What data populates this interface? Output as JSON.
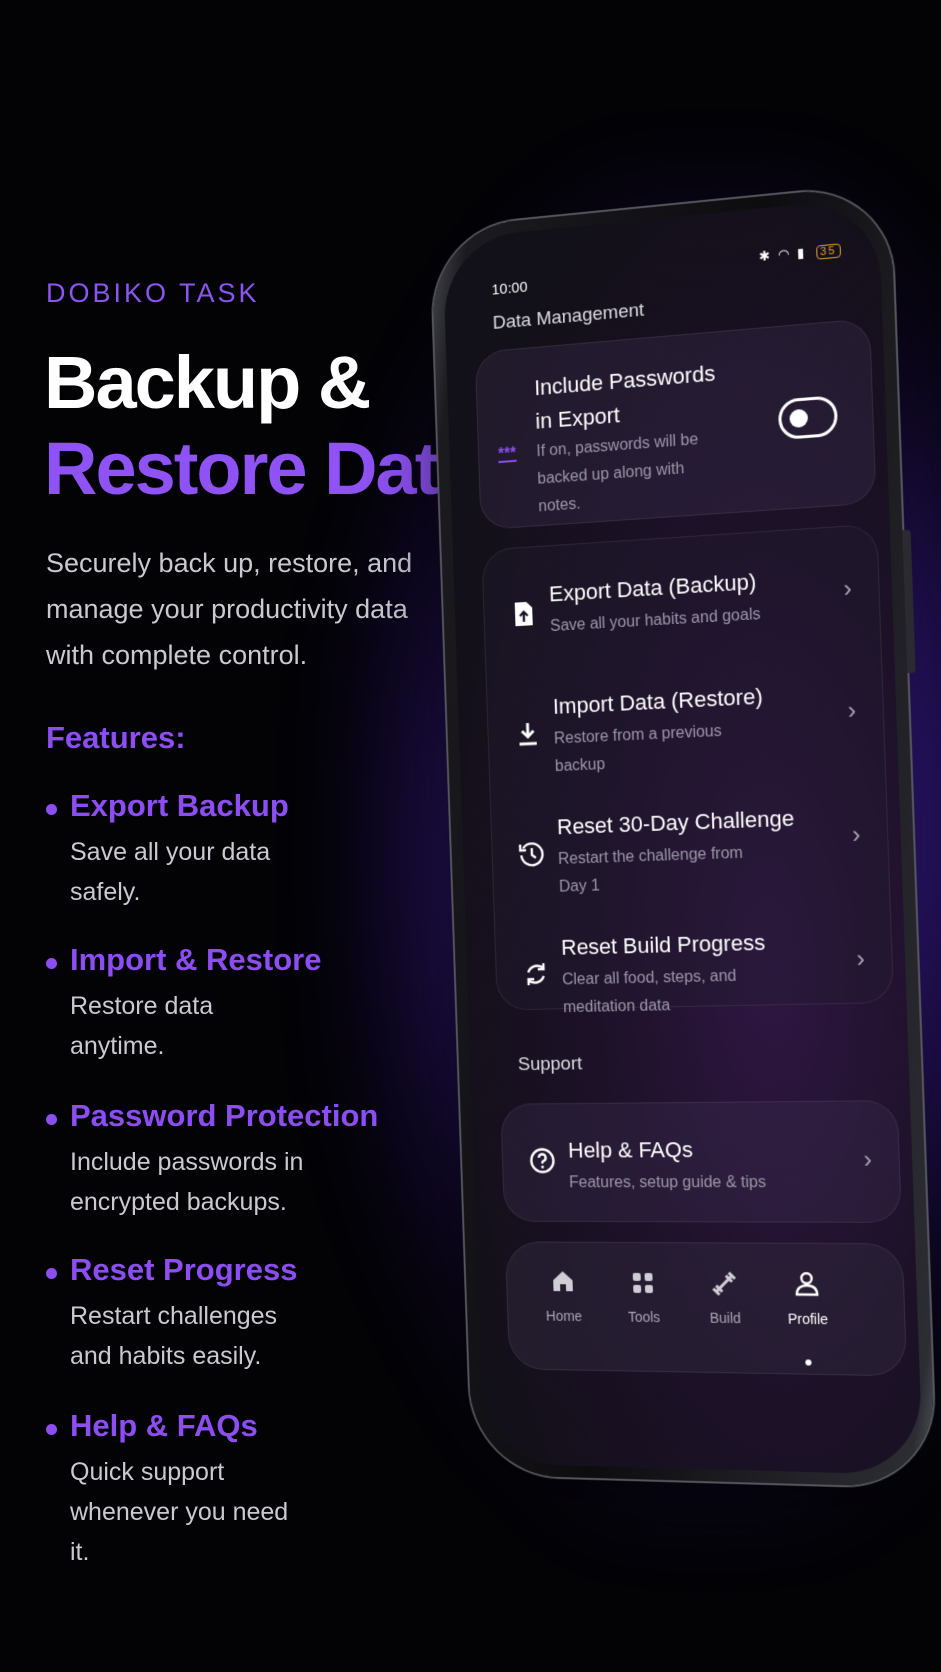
{
  "brand": "DOBIKO TASK",
  "headline": {
    "line1": "Backup &",
    "line2": "Restore Data"
  },
  "description": "Securely back up, restore, and manage your productivity data with complete control.",
  "features_title": "Features:",
  "features": [
    {
      "title": "Export Backup",
      "desc": "Save all your data safely."
    },
    {
      "title": "Import & Restore",
      "desc": "Restore data anytime."
    },
    {
      "title": "Password Protection",
      "desc": "Include passwords in encrypted backups."
    },
    {
      "title": "Reset Progress",
      "desc": "Restart challenges and habits easily."
    },
    {
      "title": "Help & FAQs",
      "desc": "Quick support whenever you need it."
    }
  ],
  "phone": {
    "status": {
      "time": "10:00",
      "battery": "35"
    },
    "data_management": {
      "title": "Data Management",
      "password_card": {
        "icon": "password-icon",
        "glyph": "***",
        "title": "Include Passwords in Export",
        "subtitle": "If on, passwords will be backed up along with notes.",
        "toggle_on": true
      },
      "items": [
        {
          "icon": "file-upload-icon",
          "title": "Export Data (Backup)",
          "subtitle": "Save all your habits and goals"
        },
        {
          "icon": "download-icon",
          "title": "Import Data (Restore)",
          "subtitle": "Restore from a previous backup"
        },
        {
          "icon": "history-icon",
          "title": "Reset 30-Day Challenge",
          "subtitle": "Restart the challenge from Day 1"
        },
        {
          "icon": "refresh-icon",
          "title": "Reset Build Progress",
          "subtitle": "Clear all food, steps, and meditation data"
        }
      ]
    },
    "support": {
      "title": "Support",
      "help": {
        "icon": "help-circle-icon",
        "title": "Help & FAQs",
        "subtitle": "Features, setup guide & tips"
      }
    },
    "nav": [
      {
        "icon": "home-icon",
        "label": "Home"
      },
      {
        "icon": "grid-icon",
        "label": "Tools"
      },
      {
        "icon": "dumbbell-icon",
        "label": "Build"
      },
      {
        "icon": "user-icon",
        "label": "Profile",
        "active": true
      }
    ]
  },
  "colors": {
    "accent": "#8c4ef2",
    "background": "#030306",
    "glow": "#6e3cff"
  }
}
